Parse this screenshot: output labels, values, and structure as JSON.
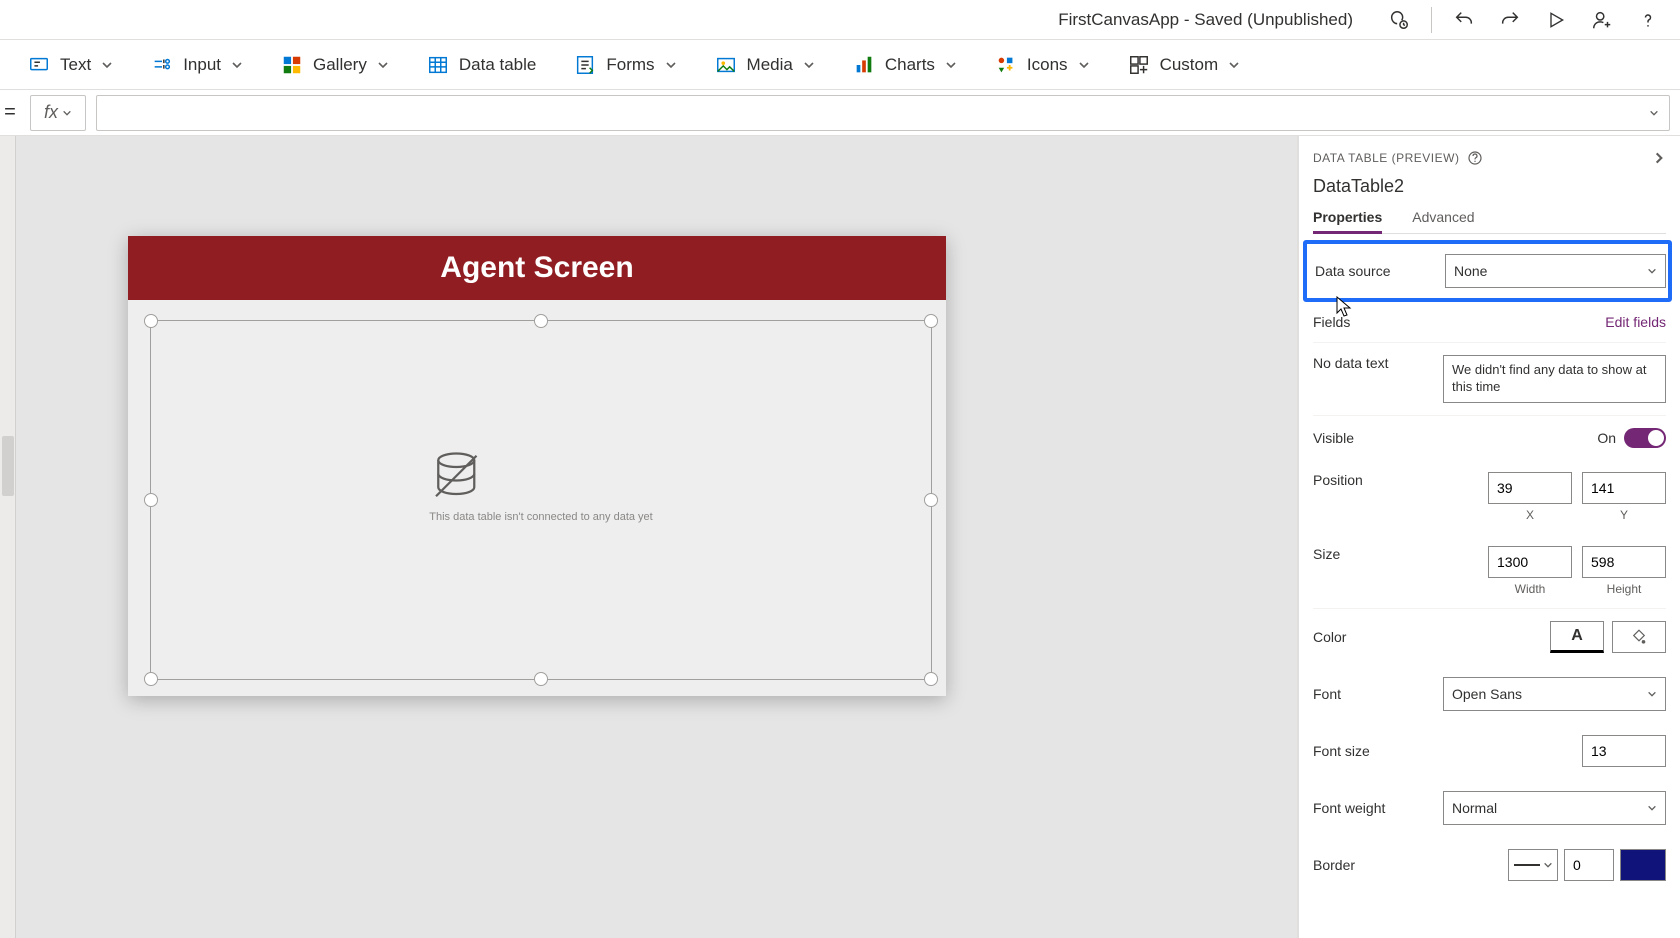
{
  "titleBar": {
    "appTitle": "FirstCanvasApp - Saved (Unpublished)"
  },
  "ribbon": {
    "text": "Text",
    "input": "Input",
    "gallery": "Gallery",
    "dataTable": "Data table",
    "forms": "Forms",
    "media": "Media",
    "charts": "Charts",
    "icons": "Icons",
    "custom": "Custom"
  },
  "formula": {
    "eq": "=",
    "fx": "fx"
  },
  "canvas": {
    "headerTitle": "Agent Screen",
    "emptyMsg": "This data table isn't connected to any data yet"
  },
  "propsPane": {
    "header": "DATA TABLE (PREVIEW)",
    "controlName": "DataTable2",
    "tabs": {
      "properties": "Properties",
      "advanced": "Advanced"
    },
    "rows": {
      "dataSource": {
        "label": "Data source",
        "value": "None"
      },
      "fields": {
        "label": "Fields",
        "action": "Edit fields"
      },
      "noDataText": {
        "label": "No data text",
        "value": "We didn't find any data to show at this time"
      },
      "visible": {
        "label": "Visible",
        "state": "On"
      },
      "position": {
        "label": "Position",
        "x": "39",
        "y": "141",
        "xLabel": "X",
        "yLabel": "Y"
      },
      "size": {
        "label": "Size",
        "w": "1300",
        "h": "598",
        "wLabel": "Width",
        "hLabel": "Height"
      },
      "color": {
        "label": "Color",
        "glyph": "A"
      },
      "font": {
        "label": "Font",
        "value": "Open Sans"
      },
      "fontSize": {
        "label": "Font size",
        "value": "13"
      },
      "fontWeight": {
        "label": "Font weight",
        "value": "Normal"
      },
      "border": {
        "label": "Border",
        "value": "0",
        "color": "#10147a"
      }
    }
  }
}
